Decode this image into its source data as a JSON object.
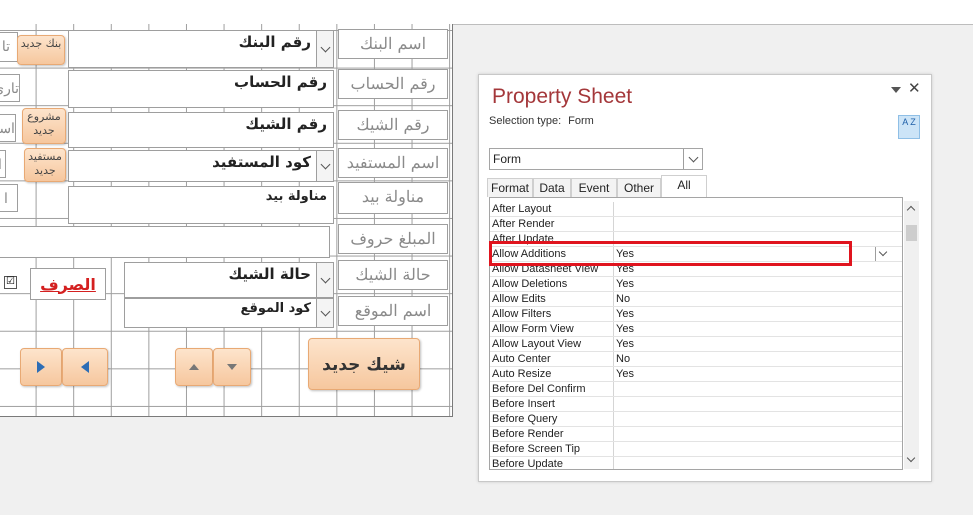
{
  "form": {
    "labels": {
      "bank_name": "اسم البنك",
      "account_no": "رقم الحساب",
      "check_no": "رقم الشيك",
      "beneficiary_name": "اسم المستفيد",
      "hand_delivery": "مناولة بيد",
      "amount_words": "المبلغ حروف",
      "check_status": "حالة الشيك",
      "location_name": "اسم الموقع"
    },
    "fields": {
      "bank_no": "رقم البنك",
      "account_no": "رقم الحساب",
      "check_no": "رقم الشيك",
      "beneficiary_code": "كود المستفيد",
      "hand_delivery": "مناولة بيد",
      "check_status": "حالة الشيك",
      "location_code": "كود الموقع"
    },
    "buttons": {
      "new_bank": "بنك جديد",
      "new_project": "مشروع جديد",
      "new_beneficiary": "مستفيد جديد",
      "new_check": "شيك جديد"
    },
    "partial_left": {
      "row1": "تا",
      "row2": "تاري",
      "row3": "اسا",
      "row4": "ا"
    },
    "disbursement_link": "الصرف",
    "checkbox_mark": "☑"
  },
  "property_sheet": {
    "title": "Property Sheet",
    "selection_type_label": "Selection type:",
    "selection_type_value": "Form",
    "selector_value": "Form",
    "tabs": [
      "Format",
      "Data",
      "Event",
      "Other",
      "All"
    ],
    "active_tab": "All",
    "sort_button": "A Z",
    "properties": [
      {
        "name": "After Layout",
        "value": ""
      },
      {
        "name": "After Render",
        "value": ""
      },
      {
        "name": "After Update",
        "value": ""
      },
      {
        "name": "Allow Additions",
        "value": "Yes"
      },
      {
        "name": "Allow Datasheet View",
        "value": "Yes"
      },
      {
        "name": "Allow Deletions",
        "value": "Yes"
      },
      {
        "name": "Allow Edits",
        "value": "No"
      },
      {
        "name": "Allow Filters",
        "value": "Yes"
      },
      {
        "name": "Allow Form View",
        "value": "Yes"
      },
      {
        "name": "Allow Layout View",
        "value": "Yes"
      },
      {
        "name": "Auto Center",
        "value": "No"
      },
      {
        "name": "Auto Resize",
        "value": "Yes"
      },
      {
        "name": "Before Del Confirm",
        "value": ""
      },
      {
        "name": "Before Insert",
        "value": ""
      },
      {
        "name": "Before Query",
        "value": ""
      },
      {
        "name": "Before Render",
        "value": ""
      },
      {
        "name": "Before Screen Tip",
        "value": ""
      },
      {
        "name": "Before Update",
        "value": ""
      }
    ],
    "highlighted_property": "Allow Additions"
  },
  "colors": {
    "title": "#a4373a",
    "highlight": "#e0141e",
    "button_orange": "#f6c79e",
    "nav_arrow": "#2d6db5"
  }
}
